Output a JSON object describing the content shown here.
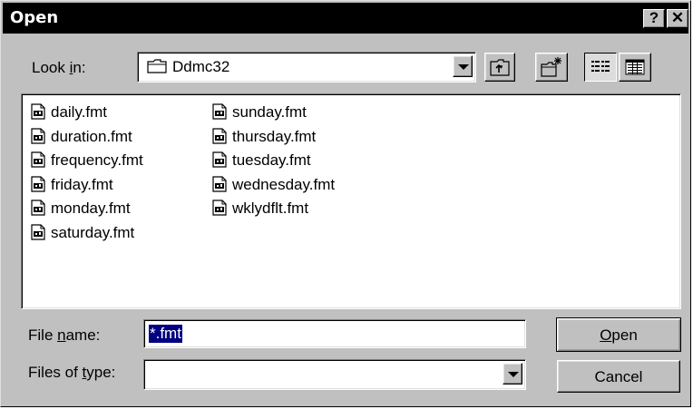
{
  "window": {
    "title": "Open",
    "help_glyph": "?",
    "close_glyph": "✕"
  },
  "look_in": {
    "label_pre": "Look ",
    "label_accel": "i",
    "label_post": "n:",
    "value": "Ddmc32",
    "icon": "folder-icon"
  },
  "toolbar": {
    "buttons": [
      "up-one-level-icon",
      "create-new-folder-icon",
      "list-view-icon",
      "details-view-icon"
    ]
  },
  "files": {
    "column1": [
      "daily.fmt",
      "duration.fmt",
      "frequency.fmt",
      "friday.fmt",
      "monday.fmt",
      "saturday.fmt"
    ],
    "column2": [
      "sunday.fmt",
      "thursday.fmt",
      "tuesday.fmt",
      "wednesday.fmt",
      "wklydflt.fmt"
    ]
  },
  "file_name": {
    "label_pre": "File ",
    "label_accel": "n",
    "label_post": "ame:",
    "value": "*.fmt"
  },
  "file_type": {
    "label_pre": "Files of ",
    "label_accel": "t",
    "label_post": "ype:",
    "value": ""
  },
  "buttons": {
    "open_accel": "O",
    "open_rest": "pen",
    "cancel": "Cancel"
  },
  "colors": {
    "face": "#c0c0c0",
    "titlebar": "#000000",
    "selection": "#000080"
  }
}
